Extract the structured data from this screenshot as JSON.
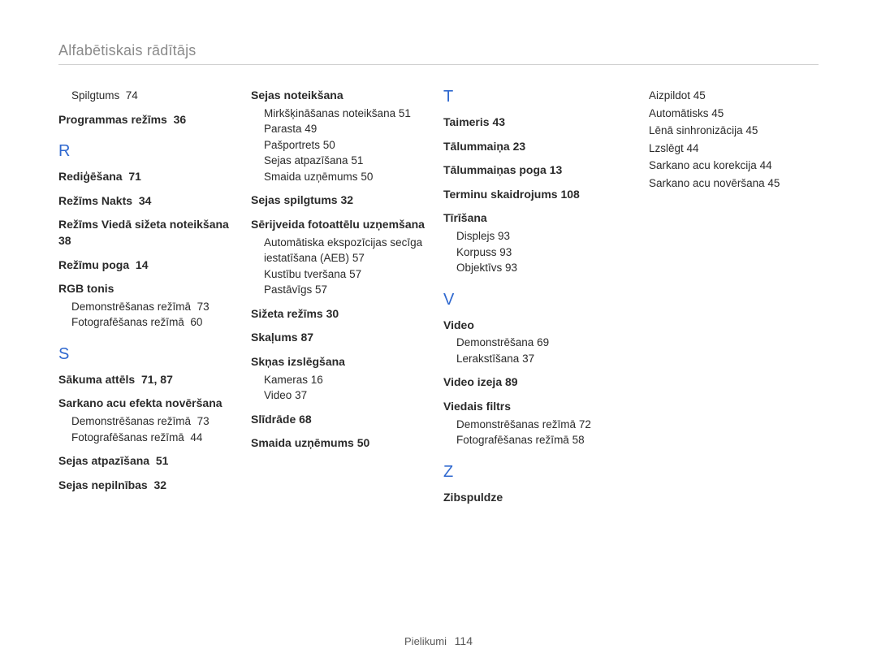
{
  "header": "Alfabētiskais rādītājs",
  "footer_label": "Pielikumi",
  "footer_page": "114",
  "col1": {
    "pre": [
      {
        "label": "Spilgtums",
        "pages": "74"
      }
    ],
    "pre_term": {
      "label": "Programmas režīms",
      "pages": "36"
    },
    "R": {
      "heading": "R",
      "items": [
        {
          "label": "Rediģēšana",
          "pages": "71"
        },
        {
          "label": "Režīms Nakts",
          "pages": "34"
        },
        {
          "label": "Režīms Viedā sižeta noteikšana",
          "pages": "38"
        },
        {
          "label": "Režīmu poga",
          "pages": "14"
        },
        {
          "label": "RGB tonis",
          "pages": "",
          "subs": [
            {
              "label": "Demonstrēšanas režīmā",
              "pages": "73"
            },
            {
              "label": "Fotografēšanas režīmā",
              "pages": "60"
            }
          ]
        }
      ]
    },
    "S": {
      "heading": "S",
      "items": [
        {
          "label": "Sākuma attēls",
          "pages": "71, 87"
        },
        {
          "label": "Sarkano acu efekta novēršana",
          "pages": "",
          "subs": [
            {
              "label": "Demonstrēšanas režīmā",
              "pages": "73"
            },
            {
              "label": "Fotografēšanas režīmā",
              "pages": "44"
            }
          ]
        },
        {
          "label": "Sejas atpazīšana",
          "pages": "51"
        },
        {
          "label": "Sejas nepilnības",
          "pages": "32"
        }
      ]
    }
  },
  "col2": {
    "first_term": {
      "label": "Sejas noteikšana",
      "pages": "",
      "subs": [
        {
          "label": "Mirkšķināšanas noteikšana",
          "pages": "51"
        },
        {
          "label": "Parasta",
          "pages": "49"
        },
        {
          "label": "Pašportrets",
          "pages": "50"
        },
        {
          "label": "Sejas atpazīšana",
          "pages": "51"
        },
        {
          "label": "Smaida uzņēmums",
          "pages": "50"
        }
      ]
    },
    "rest": [
      {
        "label": "Sejas spilgtums",
        "pages": "32"
      },
      {
        "label": "Sērijveida fotoattēlu uzņemšana",
        "pages": "",
        "subs": [
          {
            "label": "Automātiska ekspozīcijas secīga iestatīšana (AEB)",
            "pages": "57"
          },
          {
            "label": "Kustību tveršana",
            "pages": "57"
          },
          {
            "label": "Pastāvīgs",
            "pages": "57"
          }
        ]
      },
      {
        "label": "Sižeta režīms",
        "pages": "30"
      },
      {
        "label": "Skaļums",
        "pages": "87"
      },
      {
        "label": "Skņas izslēgšana",
        "pages": "",
        "subs": [
          {
            "label": "Kameras",
            "pages": "16"
          },
          {
            "label": "Video",
            "pages": "37"
          }
        ]
      },
      {
        "label": "Slīdrāde",
        "pages": "68"
      },
      {
        "label": "Smaida uzņēmums",
        "pages": "50"
      }
    ]
  },
  "col3": {
    "T": {
      "heading": "T",
      "items": [
        {
          "label": "Taimeris",
          "pages": "43"
        },
        {
          "label": "Tālummaiņa",
          "pages": "23"
        },
        {
          "label": "Tālummaiņas poga",
          "pages": "13"
        },
        {
          "label": "Terminu skaidrojums",
          "pages": "108"
        },
        {
          "label": "Tīrīšana",
          "pages": "",
          "subs": [
            {
              "label": "Displejs",
              "pages": "93"
            },
            {
              "label": "Korpuss",
              "pages": "93"
            },
            {
              "label": "Objektīvs",
              "pages": "93"
            }
          ]
        }
      ]
    },
    "V": {
      "heading": "V",
      "items": [
        {
          "label": "Video",
          "pages": "",
          "subs": [
            {
              "label": "Demonstrēšana",
              "pages": "69"
            },
            {
              "label": "Lerakstīšana",
              "pages": "37"
            }
          ]
        },
        {
          "label": "Video izeja",
          "pages": "89"
        },
        {
          "label": "Viedais filtrs",
          "pages": "",
          "subs": [
            {
              "label": "Demonstrēšanas režīmā",
              "pages": "72"
            },
            {
              "label": "Fotografēšanas režīmā",
              "pages": "58"
            }
          ]
        }
      ]
    },
    "Z": {
      "heading": "Z",
      "items": [
        {
          "label": "Zibspuldze",
          "pages": ""
        }
      ]
    }
  },
  "col4": {
    "plain": [
      {
        "label": "Aizpildot",
        "pages": "45"
      },
      {
        "label": "Automātisks",
        "pages": "45"
      },
      {
        "label": "Lēnā sinhronizācija",
        "pages": "45"
      },
      {
        "label": "Lzslēgt",
        "pages": "44"
      },
      {
        "label": "Sarkano acu korekcija",
        "pages": "44"
      },
      {
        "label": "Sarkano acu novēršana",
        "pages": "45"
      }
    ]
  }
}
